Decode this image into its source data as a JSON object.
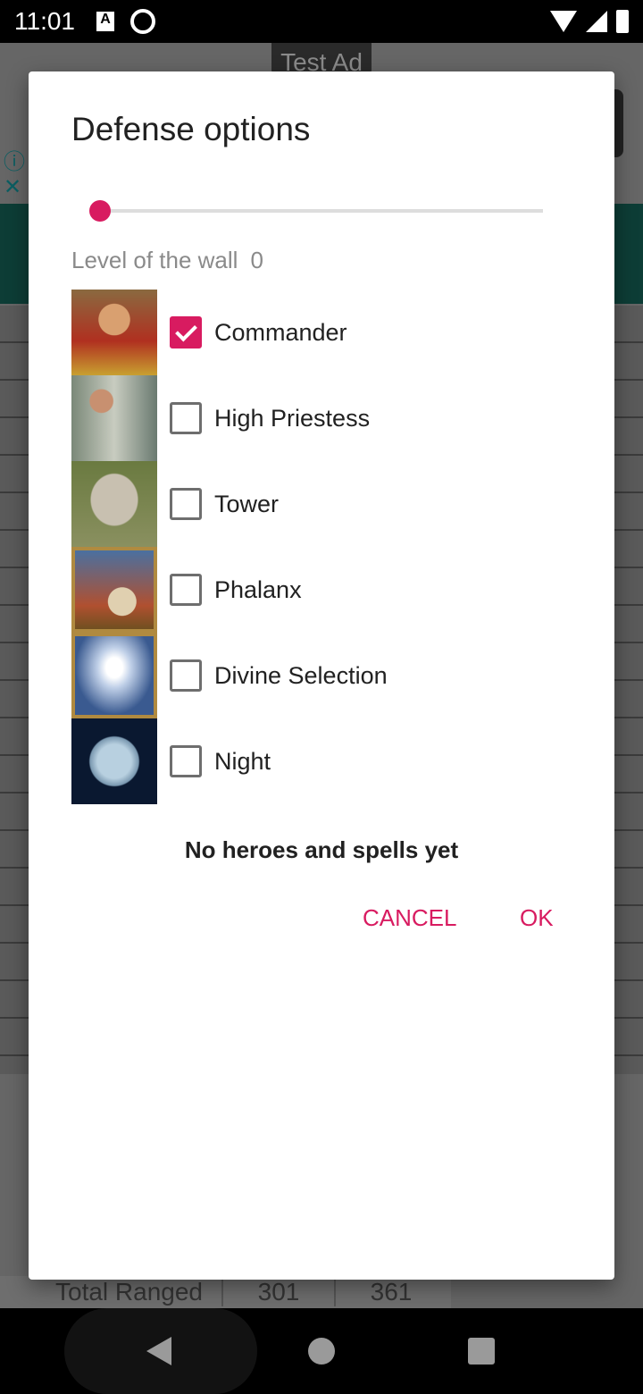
{
  "status_bar": {
    "time": "11:01",
    "icons": [
      "a-notification-icon",
      "q-notification-icon",
      "wifi-icon",
      "signal-icon",
      "battery-icon"
    ]
  },
  "background": {
    "ad_label": "Test Ad",
    "table_row": {
      "label": "Total Ranged",
      "values": [
        "301",
        "361"
      ]
    }
  },
  "dialog": {
    "title": "Defense options",
    "wall_slider": {
      "value": 0,
      "min": 0
    },
    "wall_label": "Level of the wall",
    "wall_value": "0",
    "options": [
      {
        "label": "Commander",
        "checked": true
      },
      {
        "label": "High Priestess",
        "checked": false
      },
      {
        "label": "Tower",
        "checked": false
      },
      {
        "label": "Phalanx",
        "checked": false
      },
      {
        "label": "Divine Selection",
        "checked": false
      },
      {
        "label": "Night",
        "checked": false
      }
    ],
    "note": "No heroes and spells yet",
    "cancel_label": "CANCEL",
    "ok_label": "OK"
  },
  "colors": {
    "accent": "#d81b60"
  }
}
